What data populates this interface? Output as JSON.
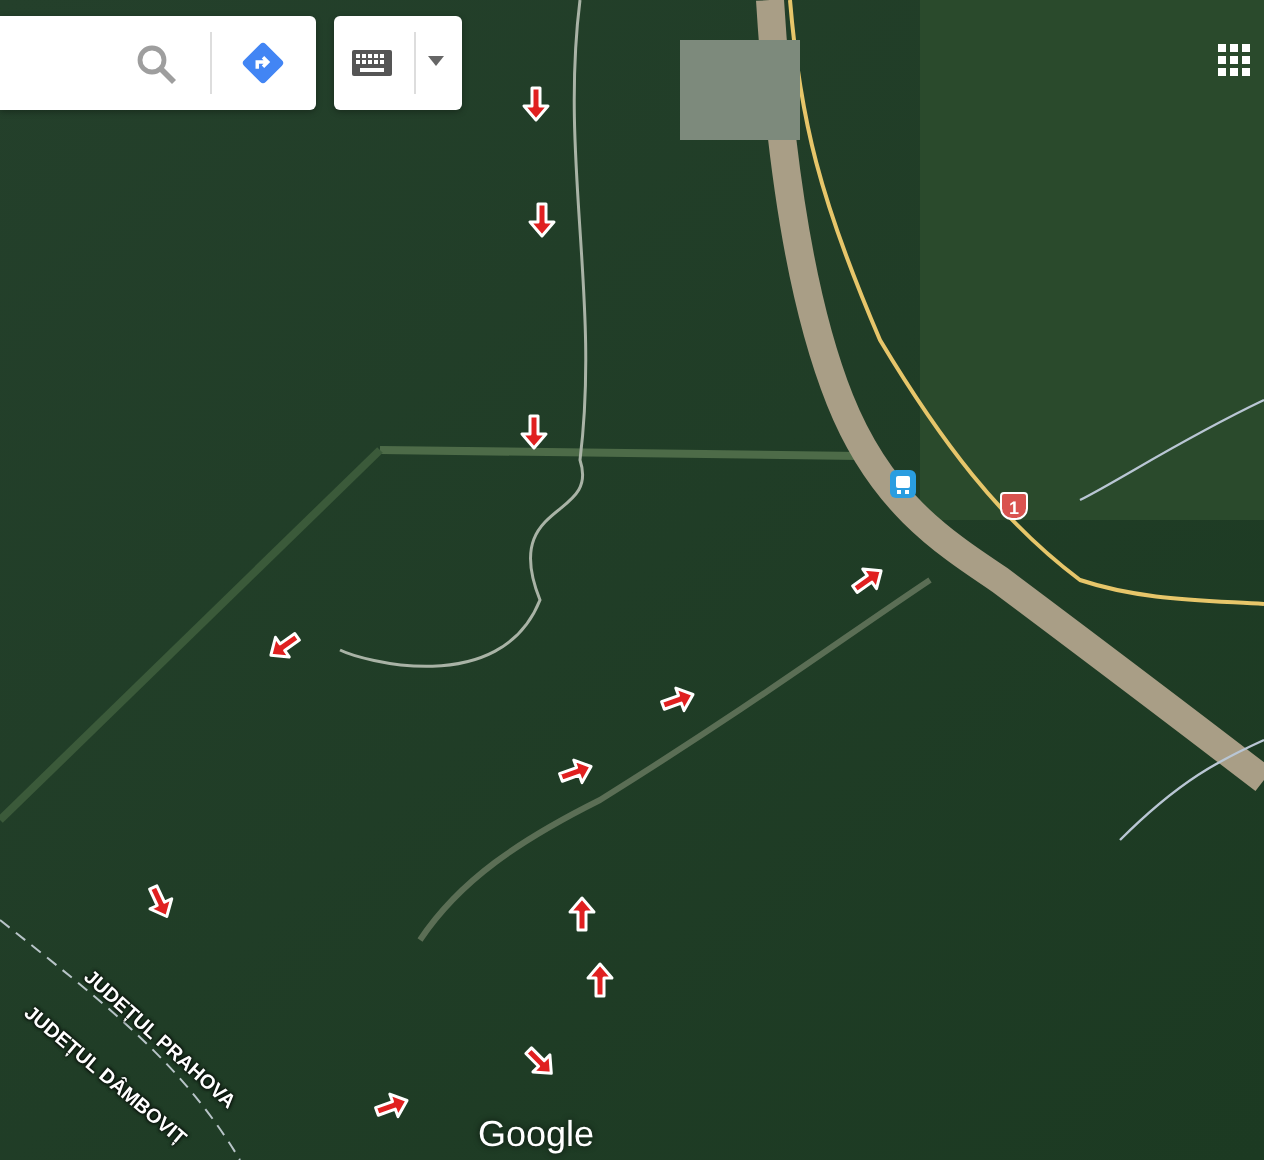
{
  "map": {
    "markers": [
      {
        "kind": "south"
      },
      {
        "kind": "south"
      },
      {
        "kind": "south"
      },
      {
        "kind": "northeast"
      },
      {
        "kind": "southwest"
      },
      {
        "kind": "eastnortheast"
      },
      {
        "kind": "eastnortheast"
      },
      {
        "kind": "southsoutheast"
      },
      {
        "kind": "north"
      },
      {
        "kind": "north"
      },
      {
        "kind": "southeast"
      },
      {
        "kind": "eastnortheast"
      }
    ],
    "road_shield": "1",
    "region_labels": [
      "JUDEȚUL PRAHOVA",
      "JUDEȚUL DÂMBOVIȚ"
    ],
    "logo": "Google"
  }
}
